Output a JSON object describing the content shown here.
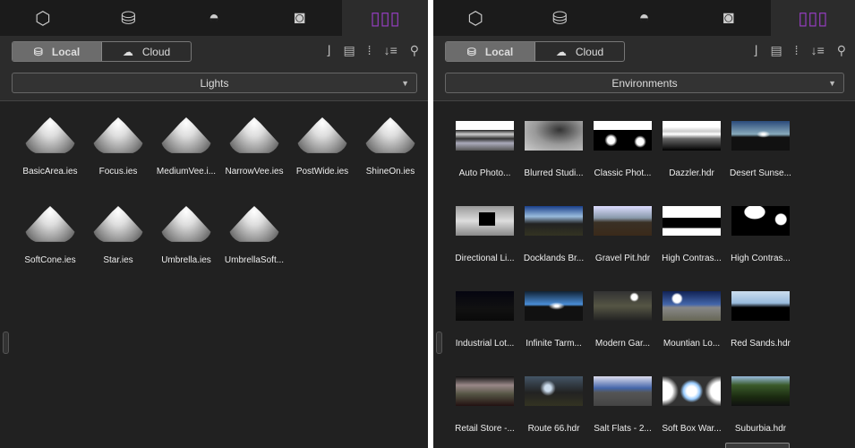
{
  "tabs": [
    {
      "icon": "cube-icon",
      "glyph": "⬡"
    },
    {
      "icon": "database-icon",
      "glyph": "⛁"
    },
    {
      "icon": "image-icon",
      "glyph": "◓"
    },
    {
      "icon": "camera-icon",
      "glyph": "📷"
    },
    {
      "icon": "library-icon",
      "glyph": "▯▯▯"
    }
  ],
  "source": {
    "local": "Local",
    "cloud": "Cloud"
  },
  "tools": [
    "⌋",
    "▤",
    "⁝",
    "↓≡",
    "⚲"
  ],
  "left": {
    "category": "Lights",
    "items": [
      "BasicArea.ies",
      "Focus.ies",
      "MediumVee.i...",
      "NarrowVee.ies",
      "PostWide.ies",
      "ShineOn.ies",
      "SoftCone.ies",
      "Star.ies",
      "Umbrella.ies",
      "UmbrellaSoft..."
    ]
  },
  "right": {
    "category": "Environments",
    "items": [
      "Auto Photo...",
      "Blurred Studi...",
      "Classic Phot...",
      "Dazzler.hdr",
      "Desert Sunse...",
      "Directional Li...",
      "Docklands Br...",
      "Gravel Pit.hdr",
      "High Contras...",
      "High Contras...",
      "Industrial Lot...",
      "Infinite Tarm...",
      "Modern Gar...",
      "Mountian Lo...",
      "Red Sands.hdr",
      "Retail Store -...",
      "Route 66.hdr",
      "Salt Flats - 2...",
      "Soft Box War...",
      "Suburbia.hdr"
    ]
  }
}
